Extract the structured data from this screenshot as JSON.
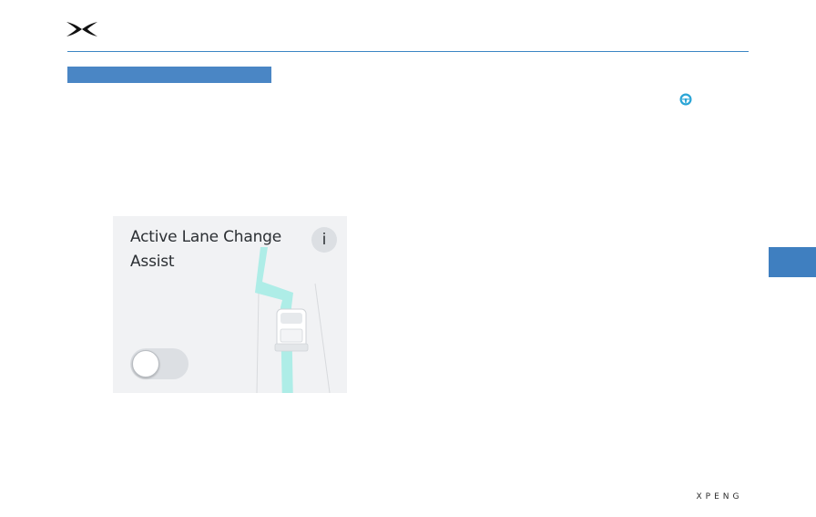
{
  "header": {
    "logo_icon": "xpeng-x-logo-icon"
  },
  "section": {
    "accent_color": "#4a86c5"
  },
  "indicator": {
    "icon": "steering-wheel-icon",
    "color": "#2aa5d6"
  },
  "card": {
    "title": "Active Lane Change Assist",
    "info_label": "i",
    "toggle_state": "off",
    "illustration": "car-lane-change-illustration"
  },
  "side_tab": {
    "color": "#3f7fc0"
  },
  "footer": {
    "brand": "XPENG"
  }
}
